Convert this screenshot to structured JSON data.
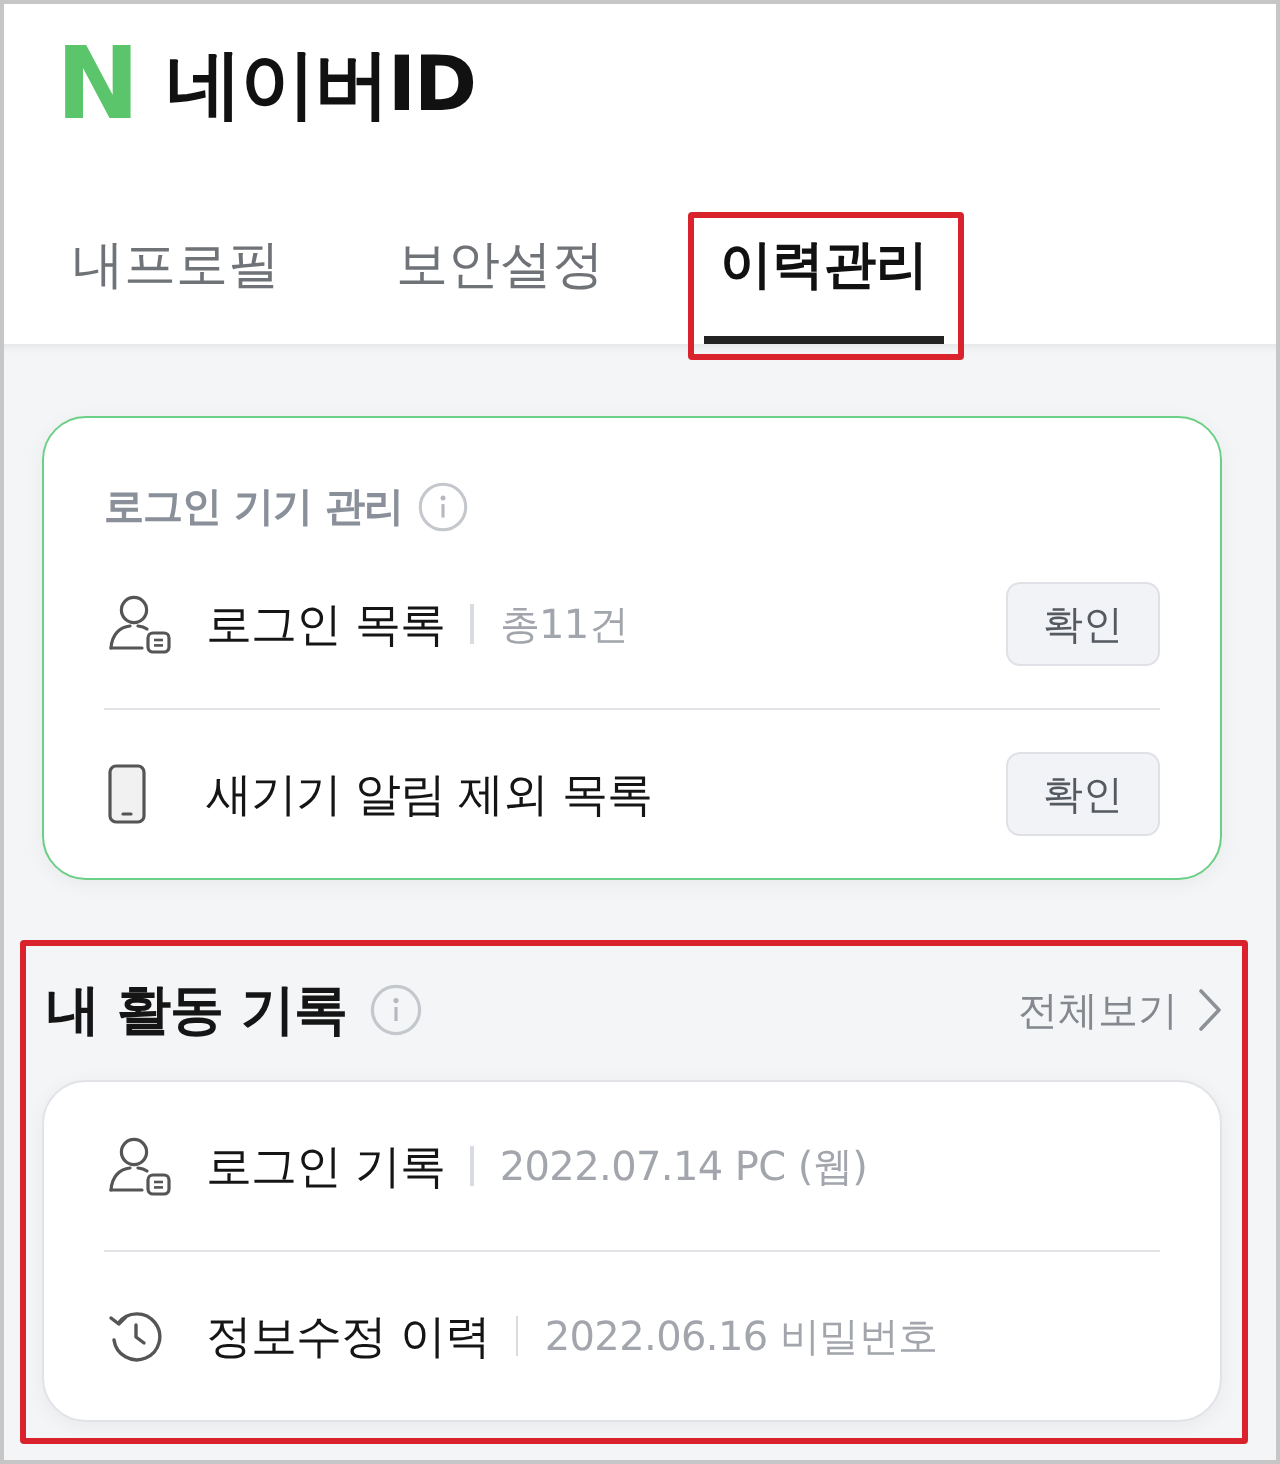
{
  "header": {
    "logo": "N",
    "title": "네이버ID"
  },
  "tabs": [
    {
      "label": "내프로필",
      "selected": false,
      "highlighted": false
    },
    {
      "label": "보안설정",
      "selected": false,
      "highlighted": false
    },
    {
      "label": "이력관리",
      "selected": true,
      "highlighted": true
    }
  ],
  "device_card": {
    "title": "로그인 기기 관리",
    "rows": [
      {
        "kind": "user",
        "label": "로그인 목록",
        "detail": "총11건",
        "button": "확인"
      },
      {
        "kind": "phone",
        "label": "새기기 알림 제외 목록",
        "button": "확인"
      }
    ]
  },
  "activity": {
    "title": "내 활동 기록",
    "link": "전체보기",
    "highlighted": true,
    "rows": [
      {
        "kind": "user",
        "label": "로그인 기록",
        "detail": "2022.07.14 PC (웹)"
      },
      {
        "kind": "history",
        "label": "정보수정 이력",
        "detail": "2022.06.16 비밀번호"
      }
    ]
  }
}
